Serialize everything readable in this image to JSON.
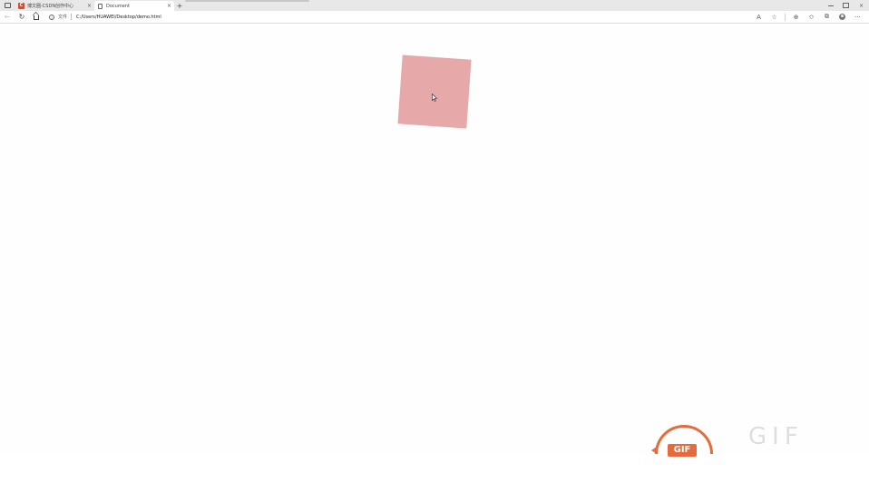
{
  "browser": {
    "tabs": [
      {
        "title": "博文圈-CSDN创作中心",
        "icon": "csdn-c-icon",
        "favicon_glyph": "C",
        "active": false,
        "close": "×"
      },
      {
        "title": "Document",
        "icon": "document-icon",
        "active": true,
        "close": "×"
      }
    ],
    "new_tab": "+",
    "window_controls": {
      "close": "×"
    },
    "toolbar": {
      "back": "←",
      "reload": "↻",
      "site_info": "i",
      "site_label": "文件",
      "url": "C:/Users/HUAWEI/Desktop/demo.html",
      "read_aloud": "A",
      "favorites_add": "☆",
      "extensions": "⊕",
      "favorites": "✩",
      "collections": "⧉",
      "more": "···"
    }
  },
  "page": {
    "box_color": "#e6a8a8",
    "background": "#fefefe"
  },
  "watermark": {
    "badge": "GIF",
    "text": "GIF"
  }
}
